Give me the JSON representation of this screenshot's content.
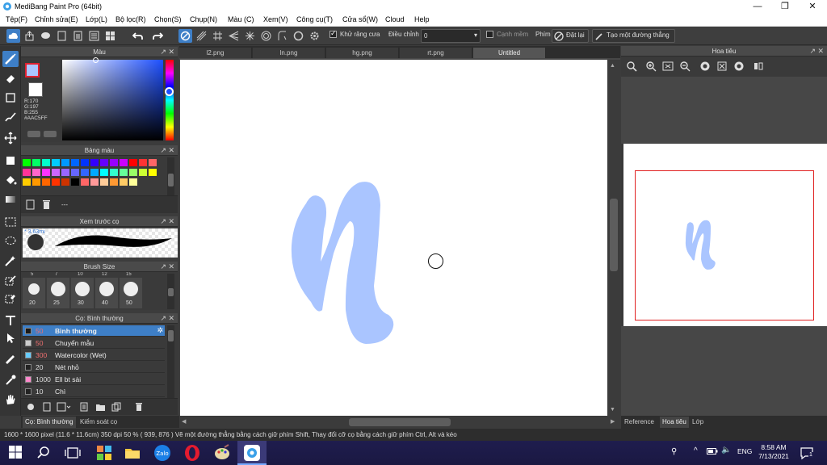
{
  "window": {
    "title": "MediBang Paint Pro (64bit)",
    "controls": {
      "minimize": "—",
      "maximize": "❐",
      "close": "✕"
    }
  },
  "menu": [
    "Tệp(F)",
    "Chỉnh sửa(E)",
    "Lớp(L)",
    "Bộ lọc(R)",
    "Chọn(S)",
    "Chụp(N)",
    "Màu (C)",
    "Xem(V)",
    "Công cụ(T)",
    "Cửa sổ(W)",
    "Cloud",
    "Help"
  ],
  "toolbar": {
    "antialias_label": "Khử răng cưa",
    "adjust_label": "Điều chỉnh",
    "adjust_value": "0",
    "edge_label": "Cạnh mềm",
    "key_label": "Phím",
    "reset_label": "Đặt lại",
    "straight_line_label": "Tạo một đường thẳng"
  },
  "color_panel": {
    "title": "Màu",
    "primary": "#AAC5FF",
    "rgb_r": "R:170",
    "rgb_g": "G:197",
    "rgb_b": "B:255",
    "hex": "#AAC5FF"
  },
  "palette_panel": {
    "title": "Bảng màu",
    "footer_text": "---",
    "swatches": [
      "#00ff00",
      "#00ff66",
      "#00ffcc",
      "#00ccff",
      "#0099ff",
      "#0066ff",
      "#0033ff",
      "#3300ff",
      "#6600ff",
      "#9900ff",
      "#cc00ff",
      "#ff0000",
      "#ff3333",
      "#ff6666",
      "#ff3399",
      "#ff66cc",
      "#ff33ff",
      "#cc66ff",
      "#9966ff",
      "#6666ff",
      "#3366ff",
      "#00aaff",
      "#00ffff",
      "#33ffcc",
      "#66ff99",
      "#99ff66",
      "#ccff33",
      "#ffff00",
      "#ffcc00",
      "#ff9900",
      "#ff6600",
      "#ff3300",
      "#cc3300",
      "#000000",
      "#ff6666",
      "#ff9999",
      "#ffcc99",
      "#ff9933",
      "#ffcc66",
      "#ffff99"
    ]
  },
  "brush_preview_panel": {
    "title": "Xem trước cọ",
    "size_label": "* 3.63mi"
  },
  "brush_size_panel": {
    "title": "Brush Size",
    "top_sizes": [
      "5",
      "7",
      "10",
      "12",
      "15"
    ],
    "sizes": [
      "20",
      "25",
      "30",
      "40",
      "50"
    ]
  },
  "brush_list_panel": {
    "title": "Cọ: Bình thường",
    "items": [
      {
        "size": "50",
        "name": "Bình thường",
        "color": "#1a1a1a",
        "selected": true
      },
      {
        "size": "50",
        "name": "Chuyển mẫu",
        "color": "#cccccc",
        "selected": false
      },
      {
        "size": "300",
        "name": "Watercolor (Wet)",
        "color": "#66ccff",
        "selected": false
      },
      {
        "size": "20",
        "name": "Nét nhỏ",
        "color": "#222222",
        "selected": false
      },
      {
        "size": "1000",
        "name": "Ell bt sài",
        "color": "#ff88cc",
        "selected": false
      },
      {
        "size": "10",
        "name": "Chì",
        "color": "#222222",
        "selected": false
      }
    ]
  },
  "left_bottom_tabs": {
    "tab1": "Cọ: Bình thường",
    "tab2": "Kiểm soát cọ"
  },
  "doc_tabs": [
    "l2.png",
    "ln.png",
    "hg.png",
    "rt.png",
    "Untitled"
  ],
  "navigator": {
    "title": "Hoa tiêu",
    "tabs": [
      "Reference",
      "Hoa tiêu",
      "Lớp"
    ]
  },
  "status": {
    "text": "1600 * 1600 pixel   (11.6 * 11.6cm)   350 dpi   50 %   ( 939, 876 )   Vẽ một đường thẳng bằng cách giữ phím Shift, Thay đổi cỡ cọ bằng cách giữ phím Ctrl, Alt và kéo"
  },
  "taskbar": {
    "time": "8:58 AM",
    "date": "7/13/2021",
    "lang": "ENG",
    "notify": "1"
  },
  "colors": {
    "accent": "#3e7fc7",
    "stroke": "#AAC5FF",
    "nav_frame": "#e02020"
  }
}
